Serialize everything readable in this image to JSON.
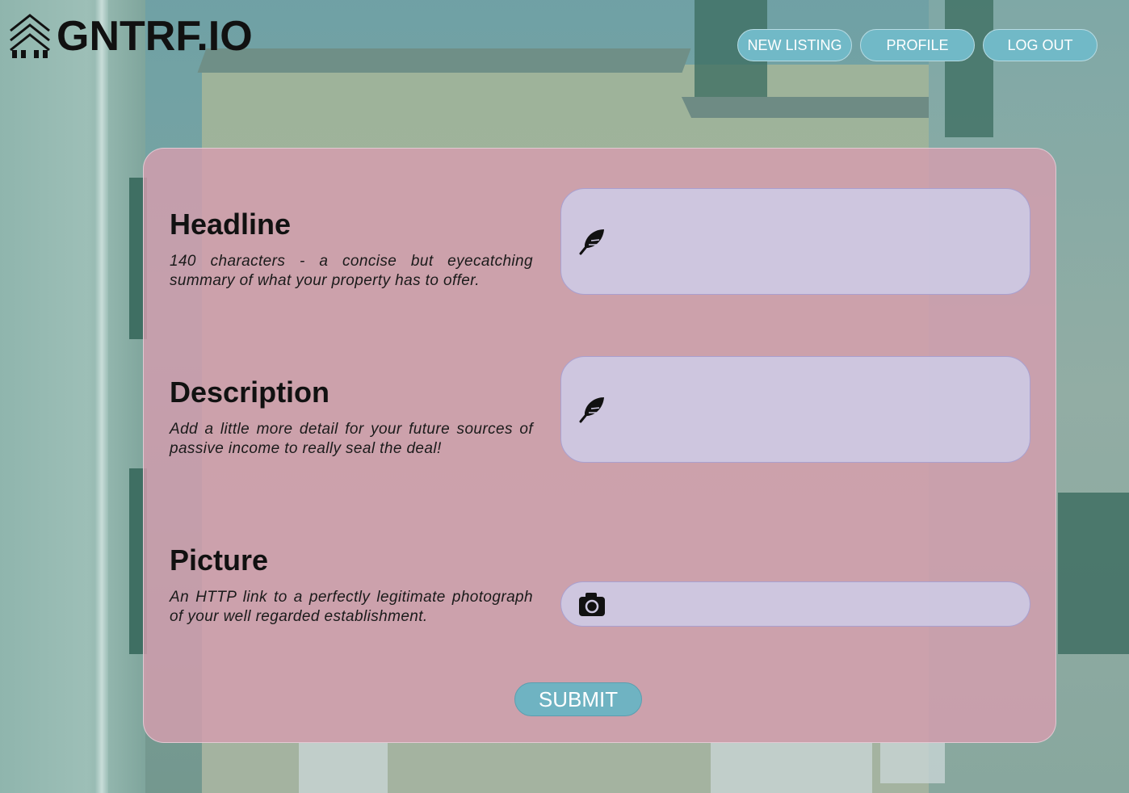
{
  "brand": {
    "name": "GNTRF.IO"
  },
  "nav": {
    "new_listing": "NEW LISTING",
    "profile": "PROFILE",
    "logout": "LOG OUT"
  },
  "form": {
    "headline": {
      "title": "Headline",
      "description": "140 characters - a concise but eyecatching summary of what your property has to offer.",
      "value": "",
      "icon": "feather-icon"
    },
    "description": {
      "title": "Description",
      "description": "Add a little more detail for your future sources of passive income to really seal the deal!",
      "value": "",
      "icon": "feather-icon"
    },
    "picture": {
      "title": "Picture",
      "description": "An HTTP link to a perfectly legitimate photograph of your well regarded establishment.",
      "value": "",
      "icon": "camera-icon"
    },
    "submit_label": "SUBMIT"
  },
  "colors": {
    "accent": "#71b9c7",
    "panel": "#d69eae",
    "input_bg": "#cdc8e1"
  }
}
